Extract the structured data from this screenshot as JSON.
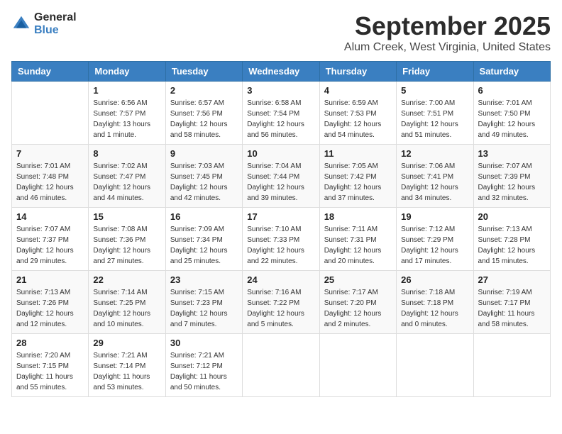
{
  "logo": {
    "line1": "General",
    "line2": "Blue"
  },
  "title": "September 2025",
  "location": "Alum Creek, West Virginia, United States",
  "weekdays": [
    "Sunday",
    "Monday",
    "Tuesday",
    "Wednesday",
    "Thursday",
    "Friday",
    "Saturday"
  ],
  "weeks": [
    [
      {
        "day": "",
        "sunrise": "",
        "sunset": "",
        "daylight": ""
      },
      {
        "day": "1",
        "sunrise": "Sunrise: 6:56 AM",
        "sunset": "Sunset: 7:57 PM",
        "daylight": "Daylight: 13 hours and 1 minute."
      },
      {
        "day": "2",
        "sunrise": "Sunrise: 6:57 AM",
        "sunset": "Sunset: 7:56 PM",
        "daylight": "Daylight: 12 hours and 58 minutes."
      },
      {
        "day": "3",
        "sunrise": "Sunrise: 6:58 AM",
        "sunset": "Sunset: 7:54 PM",
        "daylight": "Daylight: 12 hours and 56 minutes."
      },
      {
        "day": "4",
        "sunrise": "Sunrise: 6:59 AM",
        "sunset": "Sunset: 7:53 PM",
        "daylight": "Daylight: 12 hours and 54 minutes."
      },
      {
        "day": "5",
        "sunrise": "Sunrise: 7:00 AM",
        "sunset": "Sunset: 7:51 PM",
        "daylight": "Daylight: 12 hours and 51 minutes."
      },
      {
        "day": "6",
        "sunrise": "Sunrise: 7:01 AM",
        "sunset": "Sunset: 7:50 PM",
        "daylight": "Daylight: 12 hours and 49 minutes."
      }
    ],
    [
      {
        "day": "7",
        "sunrise": "Sunrise: 7:01 AM",
        "sunset": "Sunset: 7:48 PM",
        "daylight": "Daylight: 12 hours and 46 minutes."
      },
      {
        "day": "8",
        "sunrise": "Sunrise: 7:02 AM",
        "sunset": "Sunset: 7:47 PM",
        "daylight": "Daylight: 12 hours and 44 minutes."
      },
      {
        "day": "9",
        "sunrise": "Sunrise: 7:03 AM",
        "sunset": "Sunset: 7:45 PM",
        "daylight": "Daylight: 12 hours and 42 minutes."
      },
      {
        "day": "10",
        "sunrise": "Sunrise: 7:04 AM",
        "sunset": "Sunset: 7:44 PM",
        "daylight": "Daylight: 12 hours and 39 minutes."
      },
      {
        "day": "11",
        "sunrise": "Sunrise: 7:05 AM",
        "sunset": "Sunset: 7:42 PM",
        "daylight": "Daylight: 12 hours and 37 minutes."
      },
      {
        "day": "12",
        "sunrise": "Sunrise: 7:06 AM",
        "sunset": "Sunset: 7:41 PM",
        "daylight": "Daylight: 12 hours and 34 minutes."
      },
      {
        "day": "13",
        "sunrise": "Sunrise: 7:07 AM",
        "sunset": "Sunset: 7:39 PM",
        "daylight": "Daylight: 12 hours and 32 minutes."
      }
    ],
    [
      {
        "day": "14",
        "sunrise": "Sunrise: 7:07 AM",
        "sunset": "Sunset: 7:37 PM",
        "daylight": "Daylight: 12 hours and 29 minutes."
      },
      {
        "day": "15",
        "sunrise": "Sunrise: 7:08 AM",
        "sunset": "Sunset: 7:36 PM",
        "daylight": "Daylight: 12 hours and 27 minutes."
      },
      {
        "day": "16",
        "sunrise": "Sunrise: 7:09 AM",
        "sunset": "Sunset: 7:34 PM",
        "daylight": "Daylight: 12 hours and 25 minutes."
      },
      {
        "day": "17",
        "sunrise": "Sunrise: 7:10 AM",
        "sunset": "Sunset: 7:33 PM",
        "daylight": "Daylight: 12 hours and 22 minutes."
      },
      {
        "day": "18",
        "sunrise": "Sunrise: 7:11 AM",
        "sunset": "Sunset: 7:31 PM",
        "daylight": "Daylight: 12 hours and 20 minutes."
      },
      {
        "day": "19",
        "sunrise": "Sunrise: 7:12 AM",
        "sunset": "Sunset: 7:29 PM",
        "daylight": "Daylight: 12 hours and 17 minutes."
      },
      {
        "day": "20",
        "sunrise": "Sunrise: 7:13 AM",
        "sunset": "Sunset: 7:28 PM",
        "daylight": "Daylight: 12 hours and 15 minutes."
      }
    ],
    [
      {
        "day": "21",
        "sunrise": "Sunrise: 7:13 AM",
        "sunset": "Sunset: 7:26 PM",
        "daylight": "Daylight: 12 hours and 12 minutes."
      },
      {
        "day": "22",
        "sunrise": "Sunrise: 7:14 AM",
        "sunset": "Sunset: 7:25 PM",
        "daylight": "Daylight: 12 hours and 10 minutes."
      },
      {
        "day": "23",
        "sunrise": "Sunrise: 7:15 AM",
        "sunset": "Sunset: 7:23 PM",
        "daylight": "Daylight: 12 hours and 7 minutes."
      },
      {
        "day": "24",
        "sunrise": "Sunrise: 7:16 AM",
        "sunset": "Sunset: 7:22 PM",
        "daylight": "Daylight: 12 hours and 5 minutes."
      },
      {
        "day": "25",
        "sunrise": "Sunrise: 7:17 AM",
        "sunset": "Sunset: 7:20 PM",
        "daylight": "Daylight: 12 hours and 2 minutes."
      },
      {
        "day": "26",
        "sunrise": "Sunrise: 7:18 AM",
        "sunset": "Sunset: 7:18 PM",
        "daylight": "Daylight: 12 hours and 0 minutes."
      },
      {
        "day": "27",
        "sunrise": "Sunrise: 7:19 AM",
        "sunset": "Sunset: 7:17 PM",
        "daylight": "Daylight: 11 hours and 58 minutes."
      }
    ],
    [
      {
        "day": "28",
        "sunrise": "Sunrise: 7:20 AM",
        "sunset": "Sunset: 7:15 PM",
        "daylight": "Daylight: 11 hours and 55 minutes."
      },
      {
        "day": "29",
        "sunrise": "Sunrise: 7:21 AM",
        "sunset": "Sunset: 7:14 PM",
        "daylight": "Daylight: 11 hours and 53 minutes."
      },
      {
        "day": "30",
        "sunrise": "Sunrise: 7:21 AM",
        "sunset": "Sunset: 7:12 PM",
        "daylight": "Daylight: 11 hours and 50 minutes."
      },
      {
        "day": "",
        "sunrise": "",
        "sunset": "",
        "daylight": ""
      },
      {
        "day": "",
        "sunrise": "",
        "sunset": "",
        "daylight": ""
      },
      {
        "day": "",
        "sunrise": "",
        "sunset": "",
        "daylight": ""
      },
      {
        "day": "",
        "sunrise": "",
        "sunset": "",
        "daylight": ""
      }
    ]
  ]
}
